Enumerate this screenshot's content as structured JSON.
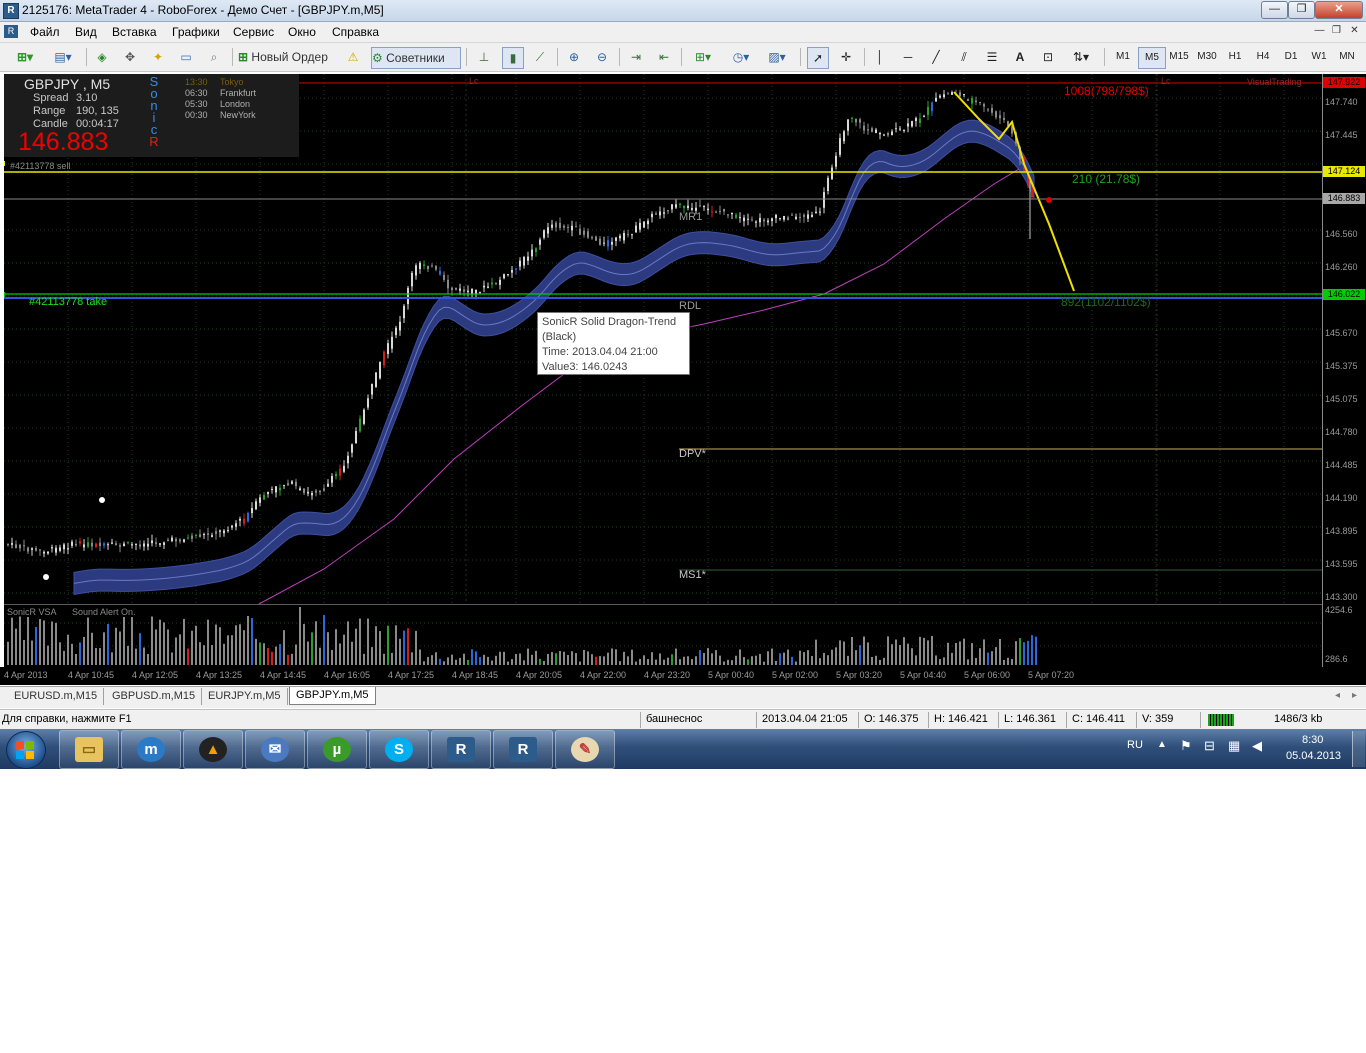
{
  "window": {
    "title": "2125176: MetaTrader 4 - RoboForex - Демо Счет - [GBPJPY.m,M5]",
    "min_label": "—",
    "max_label": "❐",
    "close_label": "✕"
  },
  "menu": {
    "items": [
      "Файл",
      "Вид",
      "Вставка",
      "Графики",
      "Сервис",
      "Окно",
      "Справка"
    ]
  },
  "toolbar": {
    "new_order_label": "Новый Ордер",
    "experts_label": "Советники",
    "timeframes": [
      "M1",
      "M5",
      "M15",
      "M30",
      "H1",
      "H4",
      "D1",
      "W1",
      "MN"
    ],
    "active_timeframe": "M5"
  },
  "chart": {
    "symbol_label": "GBPJPY , M5",
    "info": {
      "spread_label": "Spread",
      "spread_value": "3.10",
      "range_label": "Range",
      "range_value": "190, 135",
      "candle_label": "Candle",
      "candle_value": "00:04:17",
      "bid": "146.883",
      "sonic_letters": [
        "S",
        "o",
        "n",
        "i",
        "c",
        "R"
      ]
    },
    "sessions": [
      {
        "time": "13:30",
        "name": "Tokyo"
      },
      {
        "time": "06:30",
        "name": "Frankfurt"
      },
      {
        "time": "05:30",
        "name": "London"
      },
      {
        "time": "00:30",
        "name": "NewYork"
      }
    ],
    "order_sell_label": "#42113778 sell",
    "order_take_label": "#42113778  take",
    "stop_label": "1008(798/798$)",
    "mid_label": "210 (21.78$)",
    "take_profit_label": "892(1102/1102$)",
    "visual_trading_label": "VisualTrading",
    "lc_label": "Lc",
    "level_labels": {
      "mr1": "MR1",
      "rdl": "RDL",
      "dpv": "DPV*",
      "ms1": "MS1*"
    },
    "price_ticks": [
      "147.740",
      "147.445",
      "146.560",
      "146.260",
      "145.670",
      "145.375",
      "145.075",
      "144.780",
      "144.485",
      "144.190",
      "143.895",
      "143.595",
      "143.300"
    ],
    "price_tags": {
      "top": "147.922",
      "sell": "147.124",
      "bid": "146.883",
      "take": "146.022"
    },
    "time_ticks": [
      "4 Apr 2013",
      "4 Apr 10:45",
      "4 Apr 12:05",
      "4 Apr 13:25",
      "4 Apr 14:45",
      "4 Apr 16:05",
      "4 Apr 17:25",
      "4 Apr 18:45",
      "4 Apr 20:05",
      "4 Apr 22:00",
      "4 Apr 23:20",
      "5 Apr 00:40",
      "5 Apr 02:00",
      "5 Apr 03:20",
      "5 Apr 04:40",
      "5 Apr 06:00",
      "5 Apr 07:20"
    ]
  },
  "indicator": {
    "label": "SonicR VSA",
    "alert": "Sound Alert On.",
    "max_value": "4254.6",
    "min_value": "286.6"
  },
  "tooltip": {
    "line1": "SonicR Solid Dragon-Trend",
    "line2": "(Black)",
    "line3": "Time: 2013.04.04 21:00",
    "line4": "Value3: 146.0243"
  },
  "tabs": [
    "EURUSD.m,M15",
    "GBPUSD.m,M15",
    "EURJPY.m,M5",
    "GBPJPY.m,M5"
  ],
  "active_tab": "GBPJPY.m,M5",
  "status": {
    "help": "Для справки, нажмите F1",
    "profile": "башнеснос",
    "datetime": "2013.04.04 21:05",
    "open": "O: 146.375",
    "high": "H: 146.421",
    "low": "L: 146.361",
    "close": "C: 146.411",
    "volume": "V: 359",
    "traffic": "1486/3 kb"
  },
  "taskbar": {
    "lang": "RU",
    "time": "8:30",
    "date": "05.04.2013"
  }
}
